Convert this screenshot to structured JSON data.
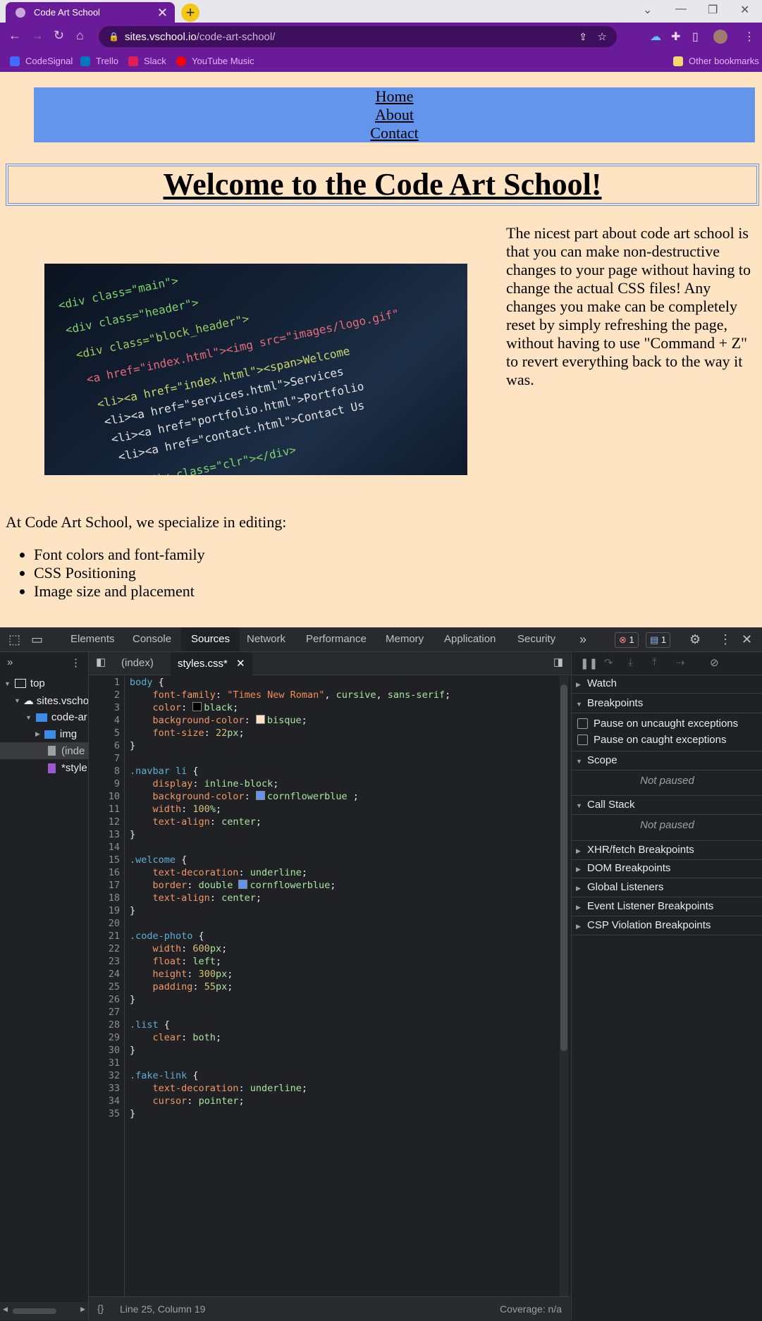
{
  "browser": {
    "tab_title": "Code Art School",
    "url_host": "sites.vschool.io",
    "url_path": "/code-art-school/",
    "bookmarks": [
      "CodeSignal",
      "Trello",
      "Slack",
      "YouTube Music"
    ],
    "other_bookmarks": "Other bookmarks"
  },
  "page": {
    "nav": [
      "Home",
      "About",
      "Contact"
    ],
    "welcome": "Welcome to the Code Art School!",
    "intro": "The nicest part about code art school is that you can make non-destructive changes to your page without having to change the actual CSS files! Any changes you make can be completely reset by simply refreshing the page, without having to use \"Command + Z\" to revert everything back to the way it was.",
    "list_intro": "At Code Art School, we specialize in editing:",
    "list": [
      "Font colors and font-family",
      "CSS Positioning",
      "Image size and placement"
    ]
  },
  "devtools": {
    "tabs": [
      "Elements",
      "Console",
      "Sources",
      "Network",
      "Performance",
      "Memory",
      "Application",
      "Security"
    ],
    "active_tab": "Sources",
    "error_count": "1",
    "message_count": "1",
    "tree": [
      "top",
      "sites.vscho",
      "code-ar",
      "img",
      "(inde",
      "*style"
    ],
    "editor_tabs": [
      "(index)",
      "styles.css*"
    ],
    "status_position": "Line 25, Column 19",
    "coverage": "Coverage: n/a",
    "debugger_sections": {
      "watch": "Watch",
      "breakpoints": "Breakpoints",
      "pause_uncaught": "Pause on uncaught exceptions",
      "pause_caught": "Pause on caught exceptions",
      "scope": "Scope",
      "not_paused": "Not paused",
      "call_stack": "Call Stack",
      "xhr": "XHR/fetch Breakpoints",
      "dom": "DOM Breakpoints",
      "global": "Global Listeners",
      "event": "Event Listener Breakpoints",
      "csp": "CSP Violation Breakpoints"
    },
    "code_lines": [
      "body {",
      "    font-family: \"Times New Roman\", cursive, sans-serif;",
      "    color: black;",
      "    background-color: bisque;",
      "    font-size: 22px;",
      "}",
      "",
      ".navbar li {",
      "    display: inline-block;",
      "    background-color: cornflowerblue ;",
      "    width: 100%;",
      "    text-align: center;",
      "}",
      "",
      ".welcome {",
      "    text-decoration: underline;",
      "    border: double cornflowerblue;",
      "    text-align: center;",
      "}",
      "",
      ".code-photo {",
      "    width: 600px;",
      "    float: left;",
      "    height: 300px;",
      "    padding: 55px;",
      "}",
      "",
      ".list {",
      "    clear: both;",
      "}",
      "",
      ".fake-link {",
      "    text-decoration: underline;",
      "    cursor: pointer;",
      "}"
    ]
  },
  "colors": {
    "bisque": "#ffe4c4",
    "cornflowerblue": "#6495ed",
    "chrome_purple": "#6a1b9a",
    "devtools_bg": "#202124"
  }
}
